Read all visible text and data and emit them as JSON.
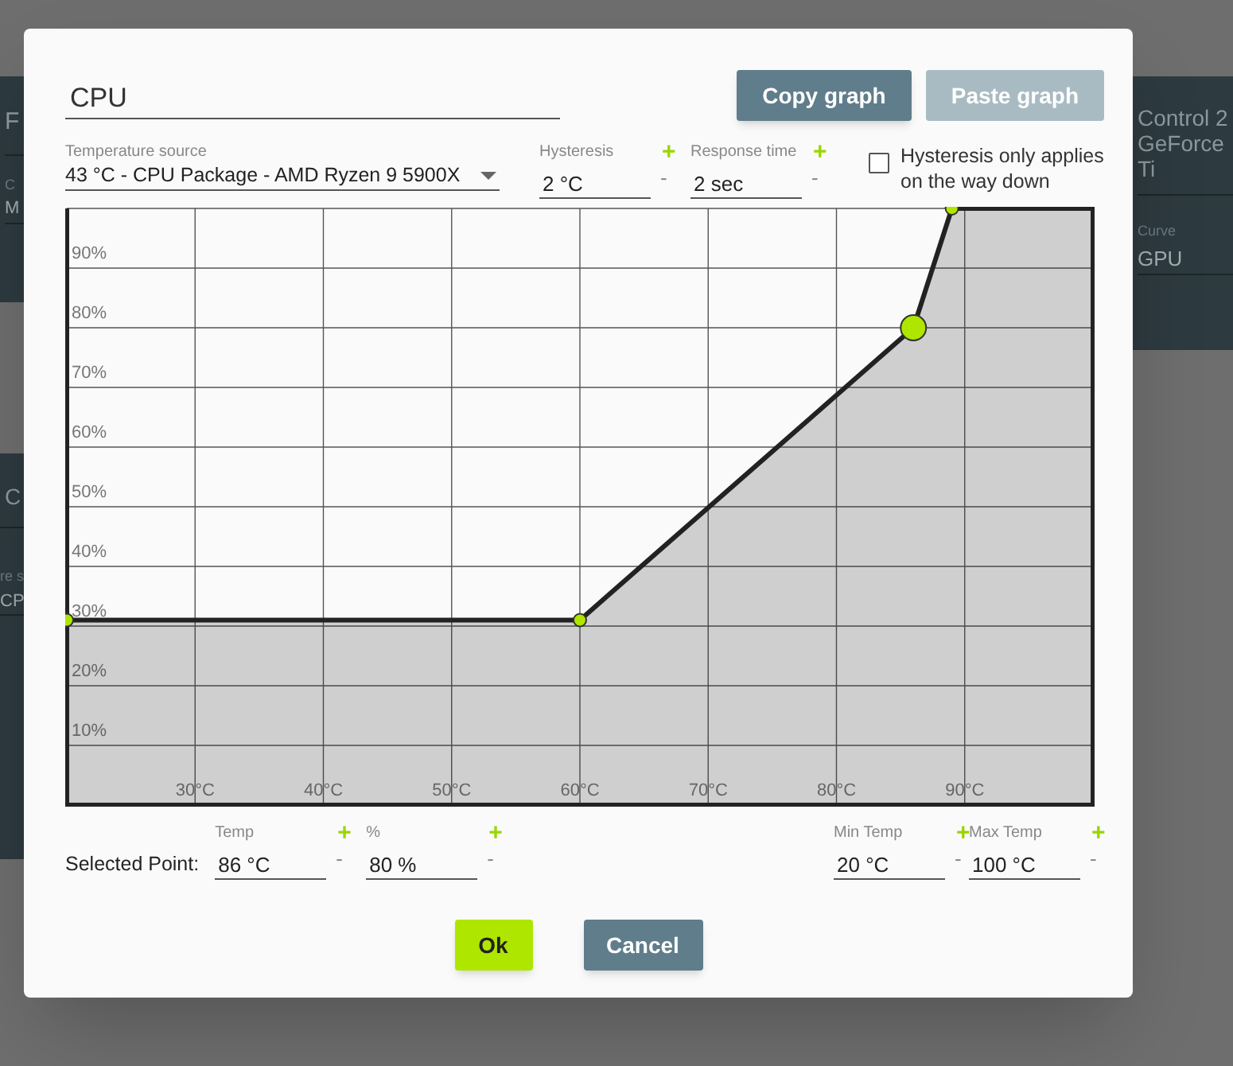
{
  "background": {
    "left_card_top": {
      "title": "F",
      "label": "C",
      "value": "M"
    },
    "left_card_bottom": {
      "title": "C",
      "label": "re s",
      "value": "CP"
    },
    "right_card": {
      "title_lines": [
        "Control 2",
        "GeForce",
        "Ti"
      ],
      "label": "Curve",
      "value": "GPU"
    }
  },
  "dialog": {
    "name": "CPU",
    "copy_button": {
      "label": "Copy graph",
      "disabled": false
    },
    "paste_button": {
      "label": "Paste graph",
      "disabled": true
    },
    "temperature_source": {
      "label": "Temperature source",
      "value": "43 °C - CPU Package - AMD Ryzen 9 5900X"
    },
    "hysteresis": {
      "label": "Hysteresis",
      "value": "2 °C",
      "plus": "+",
      "minus": "-"
    },
    "response_time": {
      "label": "Response time",
      "value": "2 sec",
      "plus": "+",
      "minus": "-"
    },
    "hysteresis_down_only": {
      "label": "Hysteresis only applies on the way down",
      "checked": false
    },
    "graph": {
      "chart_data": {
        "type": "area",
        "grid": true,
        "x": [
          20,
          60,
          86,
          89,
          100
        ],
        "series": [
          {
            "color": "#222222",
            "values": [
              31,
              31,
              80,
              100,
              100
            ]
          }
        ],
        "xlim": [
          20,
          100
        ],
        "ylim": [
          0,
          100
        ],
        "xticks": [
          {
            "value": 30,
            "label": "30°C"
          },
          {
            "value": 40,
            "label": "40°C"
          },
          {
            "value": 50,
            "label": "50°C"
          },
          {
            "value": 60,
            "label": "60°C"
          },
          {
            "value": 70,
            "label": "70°C"
          },
          {
            "value": 80,
            "label": "80°C"
          },
          {
            "value": 90,
            "label": "90°C"
          }
        ],
        "yticks": [
          {
            "value": 10,
            "label": "10%"
          },
          {
            "value": 20,
            "label": "20%"
          },
          {
            "value": 30,
            "label": "30%"
          },
          {
            "value": 40,
            "label": "40%"
          },
          {
            "value": 50,
            "label": "50%"
          },
          {
            "value": 60,
            "label": "60%"
          },
          {
            "value": 70,
            "label": "70%"
          },
          {
            "value": 80,
            "label": "80%"
          },
          {
            "value": 90,
            "label": "90%"
          }
        ]
      },
      "handles": [
        {
          "selected": false
        },
        {
          "selected": false
        },
        {
          "selected": true
        },
        {
          "selected": false
        }
      ]
    },
    "selected_point_label": "Selected Point:",
    "point_fields": [
      {
        "label": "Temp",
        "value": "86 °C",
        "plus": "+",
        "minus": "-"
      },
      {
        "label": "%",
        "value": "80 %",
        "plus": "+",
        "minus": "-"
      }
    ],
    "range_fields": [
      {
        "label": "Min Temp",
        "value": "20 °C",
        "plus": "+",
        "minus": "-"
      },
      {
        "label": "Max Temp",
        "value": "100 °C",
        "plus": "+",
        "minus": "-"
      }
    ],
    "ok_button": "Ok",
    "cancel_button": "Cancel"
  }
}
